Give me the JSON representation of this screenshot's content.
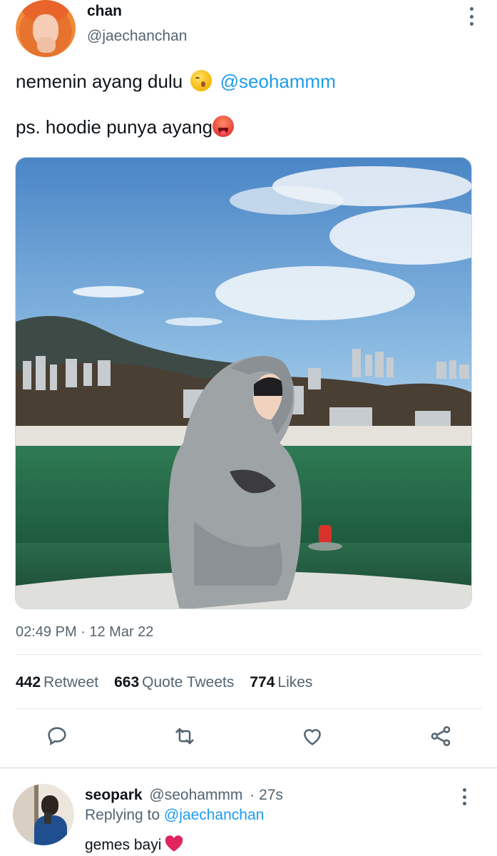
{
  "tweet": {
    "author": {
      "display_name": "chan",
      "handle": "@jaechanchan"
    },
    "text_line1": "nemenin ayang dulu",
    "text_line1_emoji": "kissing-face-emoji",
    "text_line1_mention": "@seohammm",
    "text_line2": "ps. hoodie punya ayang",
    "text_line2_emoji": "hot-face-emoji",
    "media": {
      "type": "photo"
    },
    "timestamp": "02:49 PM · 12 Mar 22",
    "stats": {
      "retweets_count": "442",
      "retweets_label": "Retweet",
      "quotes_count": "663",
      "quotes_label": "Quote Tweets",
      "likes_count": "774",
      "likes_label": "Likes"
    },
    "actions": [
      "reply-icon",
      "retweet-icon",
      "like-icon",
      "share-icon"
    ]
  },
  "reply": {
    "author": {
      "display_name": "seopark",
      "handle": "@seohammm",
      "time": "· 27s"
    },
    "replying_prefix": "Replying to",
    "replying_to": "@jaechanchan",
    "text": "gemes bayi",
    "text_emoji": "red-heart-emoji"
  },
  "colors": {
    "accent": "#1d9bf0",
    "secondary_text": "#536471",
    "text": "#0f1419",
    "divider": "#e1e8ed",
    "heart": "#e0245e"
  }
}
